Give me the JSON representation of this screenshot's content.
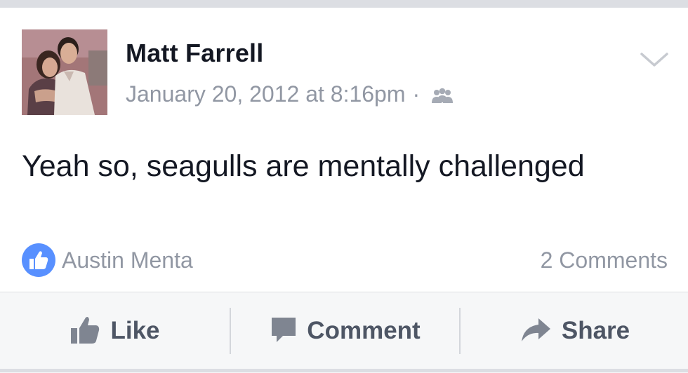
{
  "post": {
    "author": "Matt Farrell",
    "timestamp": "January 20, 2012 at 8:16pm",
    "separator": "·",
    "privacy_icon": "friends-icon",
    "text": "Yeah so, seagulls are mentally challenged",
    "menu_icon": "chevron-down-icon"
  },
  "reactions": {
    "like_icon": "thumbs-up-icon",
    "liker": "Austin Menta",
    "comments": "2 Comments"
  },
  "actions": {
    "like": "Like",
    "comment": "Comment",
    "share": "Share"
  },
  "colors": {
    "name": "#141823",
    "meta": "#9197a3",
    "like_badge": "#5890ff",
    "action_text": "#4e5665",
    "action_bar": "#f6f7f8",
    "background": "#e9eaed"
  }
}
